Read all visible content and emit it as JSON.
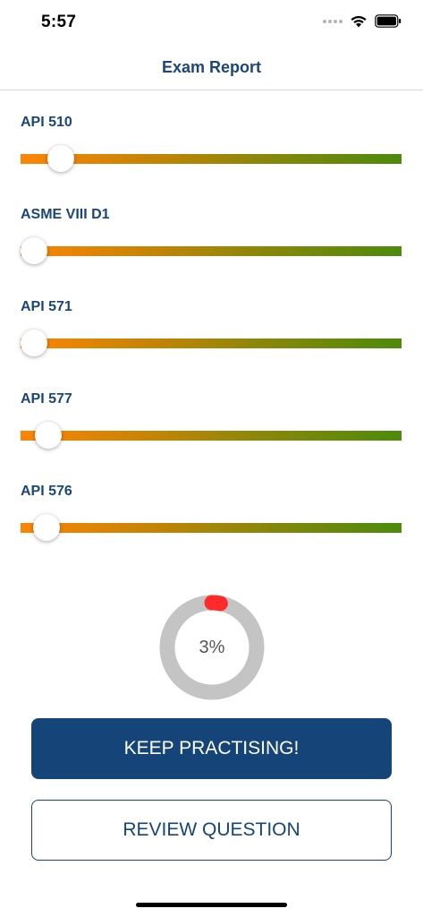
{
  "status_bar": {
    "time": "5:57"
  },
  "header": {
    "title": "Exam Report"
  },
  "subjects": [
    {
      "label": "API 510",
      "level": 0.106
    },
    {
      "label": "ASME VIII D1",
      "level": 0.035
    },
    {
      "label": "API 571",
      "level": 0.035
    },
    {
      "label": "API 577",
      "level": 0.073
    },
    {
      "label": "API 576",
      "level": 0.068
    }
  ],
  "score": {
    "percent_label": "3%",
    "value": 0.03,
    "ring_color": "#c4c4c4",
    "progress_color": "#ff2b2b"
  },
  "buttons": {
    "keep_practising": "KEEP PRACTISING!",
    "review_question": "REVIEW QUESTION"
  },
  "colors": {
    "brand": "#154578",
    "title": "#1a4678"
  }
}
